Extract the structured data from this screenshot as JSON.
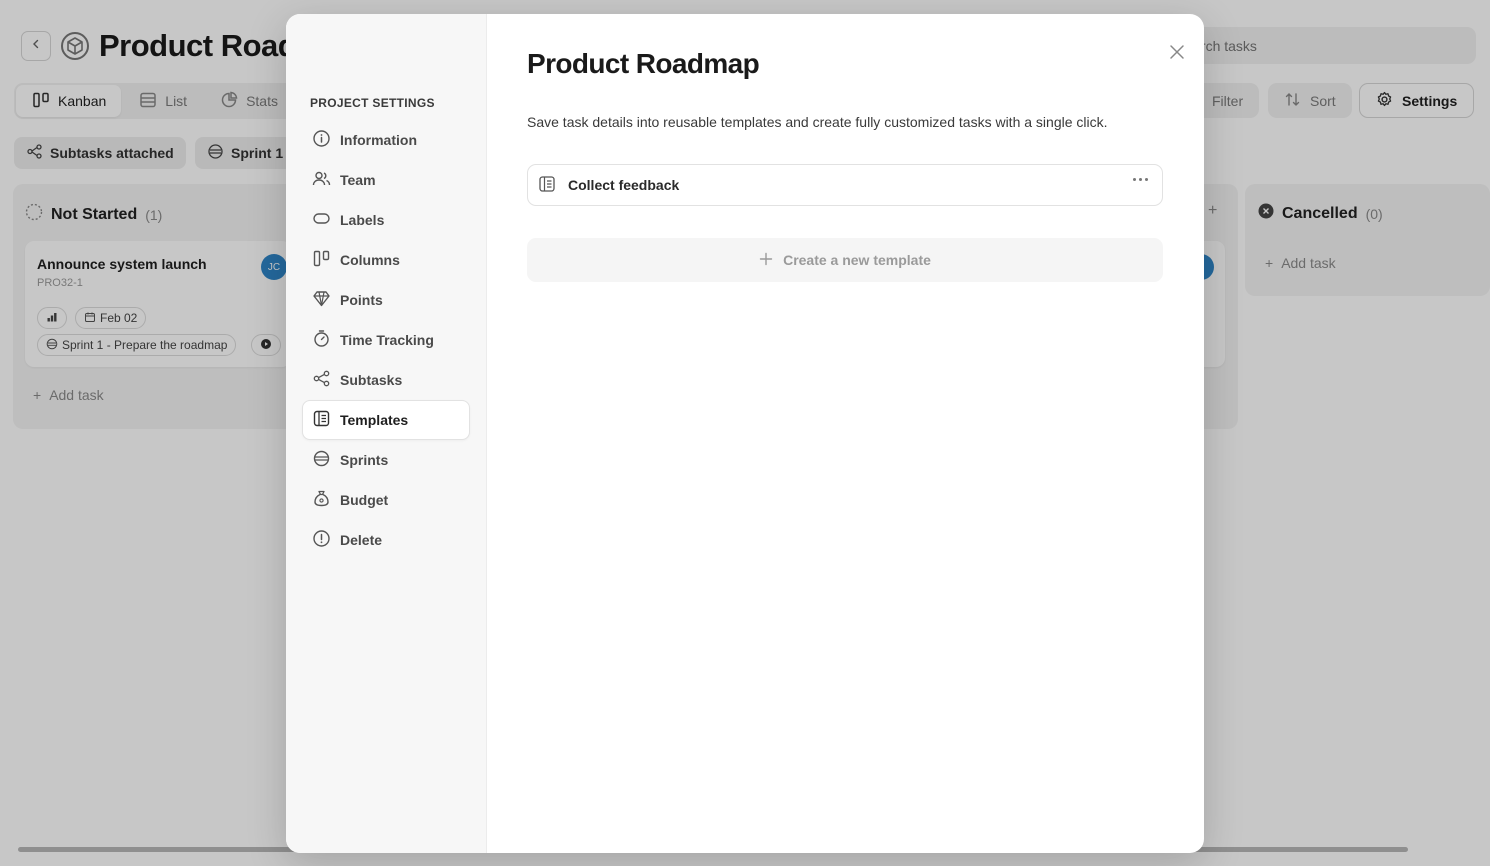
{
  "app": {
    "project_title": "Product Roadmap",
    "search_placeholder": "Search tasks",
    "view_tabs": [
      {
        "label": "Kanban",
        "icon": "columns-icon",
        "active": true
      },
      {
        "label": "List",
        "icon": "list-icon",
        "active": false
      },
      {
        "label": "Stats",
        "icon": "pie-chart-icon",
        "active": false
      }
    ],
    "toolbar": {
      "filter_label": "Filter",
      "sort_label": "Sort",
      "settings_label": "Settings"
    },
    "chips": {
      "subtasks_label": "Subtasks attached",
      "sprint_label": "Sprint 1"
    },
    "columns": {
      "not_started": {
        "title": "Not Started",
        "count": "(1)",
        "card": {
          "title": "Announce system launch",
          "id": "PRO32-1",
          "avatar": "JC",
          "due": "Feb 02",
          "sprint": "Sprint 1 - Prepare the roadmap"
        },
        "add_task": "Add task"
      },
      "cancelled": {
        "title": "Cancelled",
        "count": "(0)",
        "add_task": "Add task"
      }
    }
  },
  "modal": {
    "sidebar_heading": "PROJECT SETTINGS",
    "nav": [
      {
        "label": "Information",
        "icon": "info-icon"
      },
      {
        "label": "Team",
        "icon": "team-icon"
      },
      {
        "label": "Labels",
        "icon": "label-icon"
      },
      {
        "label": "Columns",
        "icon": "columns-icon"
      },
      {
        "label": "Points",
        "icon": "diamond-icon"
      },
      {
        "label": "Time Tracking",
        "icon": "stopwatch-icon"
      },
      {
        "label": "Subtasks",
        "icon": "subtasks-icon"
      },
      {
        "label": "Templates",
        "icon": "template-icon",
        "active": true
      },
      {
        "label": "Sprints",
        "icon": "sprint-icon"
      },
      {
        "label": "Budget",
        "icon": "money-bag-icon"
      },
      {
        "label": "Delete",
        "icon": "alert-icon"
      }
    ],
    "title": "Product Roadmap",
    "description": "Save task details into reusable templates and create fully customized tasks with a single click.",
    "templates": [
      {
        "name": "Collect feedback"
      }
    ],
    "create_label": "Create a new template"
  }
}
